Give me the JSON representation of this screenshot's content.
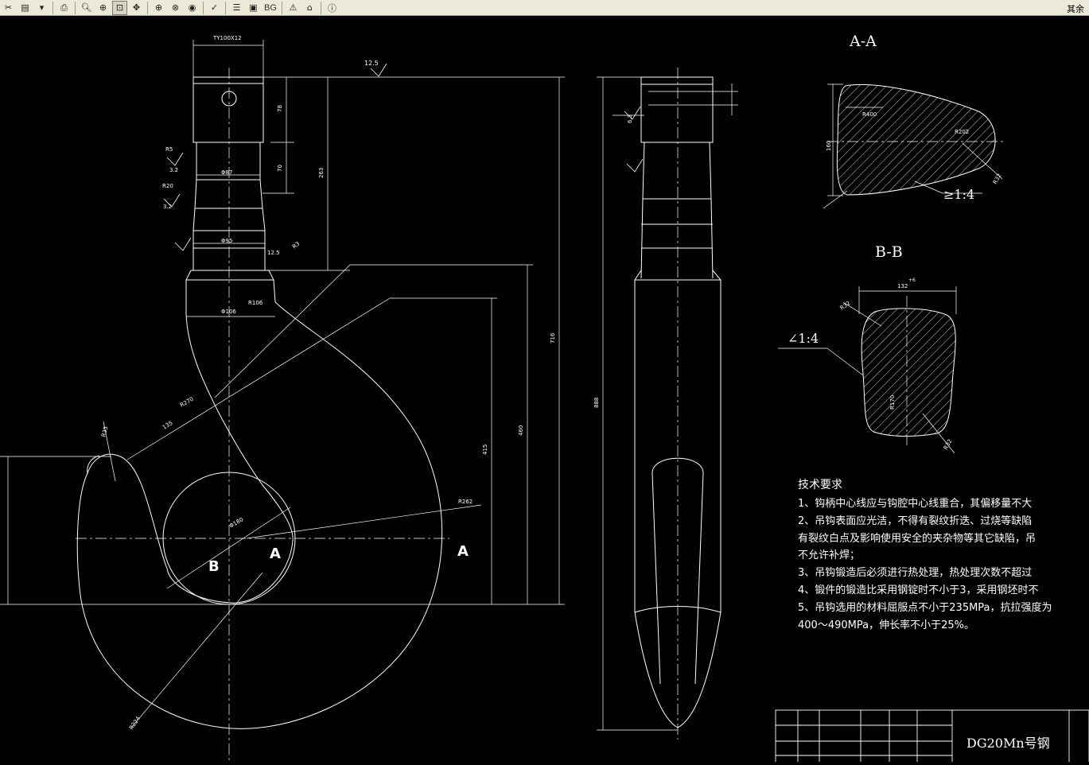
{
  "toolbar": {
    "bg_label": "BG",
    "right_text": "其余"
  },
  "drawing": {
    "section_aa": "A-A",
    "section_bb": "B-B",
    "marker_a": "A",
    "marker_b": "B",
    "marker_a_right": "A",
    "taper_aa": "1:4",
    "taper_bb": "1:4",
    "dims": {
      "thread": "TY100X12",
      "r125": "12.5",
      "d78": "78",
      "d70": "70",
      "d263": "263",
      "d716": "716",
      "d460": "460",
      "d415": "415",
      "d888": "888",
      "phi87": "Φ87",
      "phi95": "Φ95",
      "phi106": "Φ106",
      "r106": "R106",
      "r270": "R270",
      "d135": "135",
      "r262": "R262",
      "r224": "R224",
      "phi180": "Φ180",
      "r35": "R35",
      "r20": "R20",
      "r3": "R3",
      "r5": "R5",
      "s32a": "3.2",
      "s32b": "3.2",
      "s63": "6.3",
      "s125b": "12.5",
      "r400": "R400",
      "r202": "R202",
      "r32": "R32",
      "d160": "160",
      "d132": "132",
      "tol6": "+6",
      "r832": "R32",
      "r170": "R170",
      "r32b": "R32"
    },
    "notes": {
      "title": "技术要求",
      "lines": [
        "1、钩柄中心线应与钩腔中心线重合，其偏移量不大",
        "2、吊钩表面应光洁，不得有裂纹折迭、过烧等缺陷",
        "有裂纹白点及影响使用安全的夹杂物等其它缺陷，吊",
        "不允许补焊；",
        "3、吊钩锻造后必须进行热处理，热处理次数不超过",
        "4、锻件的锻造比采用钢锭时不小于3，采用钢坯时不",
        "5、吊钩选用的材料屈服点不小于235MPa，抗拉强度为",
        "400～490MPa，伸长率不小于25%。"
      ]
    },
    "title_block": {
      "material": "DG20Mn号钢"
    }
  }
}
